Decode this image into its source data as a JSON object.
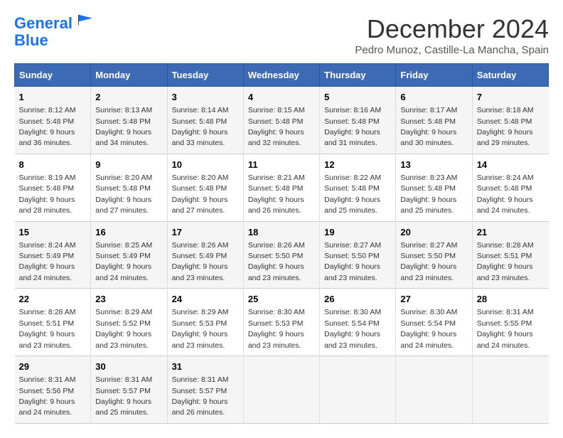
{
  "logo": {
    "line1": "General",
    "line2": "Blue"
  },
  "title": "December 2024",
  "location": "Pedro Munoz, Castille-La Mancha, Spain",
  "days_of_week": [
    "Sunday",
    "Monday",
    "Tuesday",
    "Wednesday",
    "Thursday",
    "Friday",
    "Saturday"
  ],
  "weeks": [
    [
      {
        "day": "1",
        "sunrise": "8:12 AM",
        "sunset": "5:48 PM",
        "daylight": "9 hours and 36 minutes."
      },
      {
        "day": "2",
        "sunrise": "8:13 AM",
        "sunset": "5:48 PM",
        "daylight": "9 hours and 34 minutes."
      },
      {
        "day": "3",
        "sunrise": "8:14 AM",
        "sunset": "5:48 PM",
        "daylight": "9 hours and 33 minutes."
      },
      {
        "day": "4",
        "sunrise": "8:15 AM",
        "sunset": "5:48 PM",
        "daylight": "9 hours and 32 minutes."
      },
      {
        "day": "5",
        "sunrise": "8:16 AM",
        "sunset": "5:48 PM",
        "daylight": "9 hours and 31 minutes."
      },
      {
        "day": "6",
        "sunrise": "8:17 AM",
        "sunset": "5:48 PM",
        "daylight": "9 hours and 30 minutes."
      },
      {
        "day": "7",
        "sunrise": "8:18 AM",
        "sunset": "5:48 PM",
        "daylight": "9 hours and 29 minutes."
      }
    ],
    [
      {
        "day": "8",
        "sunrise": "8:19 AM",
        "sunset": "5:48 PM",
        "daylight": "9 hours and 28 minutes."
      },
      {
        "day": "9",
        "sunrise": "8:20 AM",
        "sunset": "5:48 PM",
        "daylight": "9 hours and 27 minutes."
      },
      {
        "day": "10",
        "sunrise": "8:20 AM",
        "sunset": "5:48 PM",
        "daylight": "9 hours and 27 minutes."
      },
      {
        "day": "11",
        "sunrise": "8:21 AM",
        "sunset": "5:48 PM",
        "daylight": "9 hours and 26 minutes."
      },
      {
        "day": "12",
        "sunrise": "8:22 AM",
        "sunset": "5:48 PM",
        "daylight": "9 hours and 25 minutes."
      },
      {
        "day": "13",
        "sunrise": "8:23 AM",
        "sunset": "5:48 PM",
        "daylight": "9 hours and 25 minutes."
      },
      {
        "day": "14",
        "sunrise": "8:24 AM",
        "sunset": "5:48 PM",
        "daylight": "9 hours and 24 minutes."
      }
    ],
    [
      {
        "day": "15",
        "sunrise": "8:24 AM",
        "sunset": "5:49 PM",
        "daylight": "9 hours and 24 minutes."
      },
      {
        "day": "16",
        "sunrise": "8:25 AM",
        "sunset": "5:49 PM",
        "daylight": "9 hours and 24 minutes."
      },
      {
        "day": "17",
        "sunrise": "8:26 AM",
        "sunset": "5:49 PM",
        "daylight": "9 hours and 23 minutes."
      },
      {
        "day": "18",
        "sunrise": "8:26 AM",
        "sunset": "5:50 PM",
        "daylight": "9 hours and 23 minutes."
      },
      {
        "day": "19",
        "sunrise": "8:27 AM",
        "sunset": "5:50 PM",
        "daylight": "9 hours and 23 minutes."
      },
      {
        "day": "20",
        "sunrise": "8:27 AM",
        "sunset": "5:50 PM",
        "daylight": "9 hours and 23 minutes."
      },
      {
        "day": "21",
        "sunrise": "8:28 AM",
        "sunset": "5:51 PM",
        "daylight": "9 hours and 23 minutes."
      }
    ],
    [
      {
        "day": "22",
        "sunrise": "8:28 AM",
        "sunset": "5:51 PM",
        "daylight": "9 hours and 23 minutes."
      },
      {
        "day": "23",
        "sunrise": "8:29 AM",
        "sunset": "5:52 PM",
        "daylight": "9 hours and 23 minutes."
      },
      {
        "day": "24",
        "sunrise": "8:29 AM",
        "sunset": "5:53 PM",
        "daylight": "9 hours and 23 minutes."
      },
      {
        "day": "25",
        "sunrise": "8:30 AM",
        "sunset": "5:53 PM",
        "daylight": "9 hours and 23 minutes."
      },
      {
        "day": "26",
        "sunrise": "8:30 AM",
        "sunset": "5:54 PM",
        "daylight": "9 hours and 23 minutes."
      },
      {
        "day": "27",
        "sunrise": "8:30 AM",
        "sunset": "5:54 PM",
        "daylight": "9 hours and 24 minutes."
      },
      {
        "day": "28",
        "sunrise": "8:31 AM",
        "sunset": "5:55 PM",
        "daylight": "9 hours and 24 minutes."
      }
    ],
    [
      {
        "day": "29",
        "sunrise": "8:31 AM",
        "sunset": "5:56 PM",
        "daylight": "9 hours and 24 minutes."
      },
      {
        "day": "30",
        "sunrise": "8:31 AM",
        "sunset": "5:57 PM",
        "daylight": "9 hours and 25 minutes."
      },
      {
        "day": "31",
        "sunrise": "8:31 AM",
        "sunset": "5:57 PM",
        "daylight": "9 hours and 26 minutes."
      },
      null,
      null,
      null,
      null
    ]
  ],
  "labels": {
    "sunrise": "Sunrise:",
    "sunset": "Sunset:",
    "daylight": "Daylight:"
  }
}
